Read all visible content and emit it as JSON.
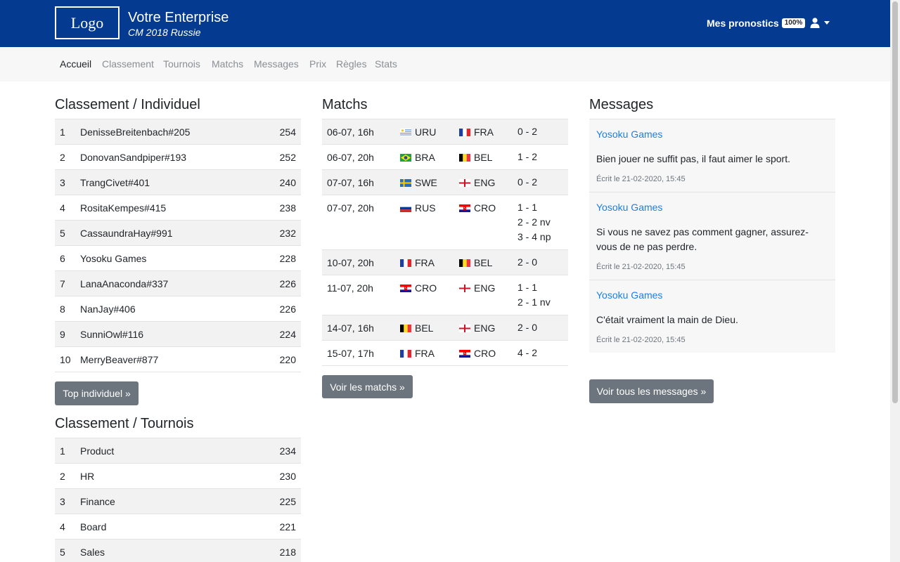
{
  "header": {
    "logo": "Logo",
    "title": "Votre Enterprise",
    "subtitle": "CM 2018 Russie",
    "pronostics_label": "Mes pronostics",
    "pronostics_badge": "100%"
  },
  "nav": [
    "Accueil",
    "Classement",
    "Tournois",
    "Matchs",
    "Messages",
    "Prix",
    "Règles",
    "Stats"
  ],
  "individual": {
    "title": "Classement / Individuel",
    "rows": [
      {
        "rank": "1",
        "name": "DenisseBreitenbach#205",
        "score": "254"
      },
      {
        "rank": "2",
        "name": "DonovanSandpiper#193",
        "score": "252"
      },
      {
        "rank": "3",
        "name": "TrangCivet#401",
        "score": "240"
      },
      {
        "rank": "4",
        "name": "RositaKempes#415",
        "score": "238"
      },
      {
        "rank": "5",
        "name": "CassaundraHay#991",
        "score": "232"
      },
      {
        "rank": "6",
        "name": "Yosoku Games",
        "score": "228"
      },
      {
        "rank": "7",
        "name": "LanaAnaconda#337",
        "score": "226"
      },
      {
        "rank": "8",
        "name": "NanJay#406",
        "score": "226"
      },
      {
        "rank": "9",
        "name": "SunniOwl#116",
        "score": "224"
      },
      {
        "rank": "10",
        "name": "MerryBeaver#877",
        "score": "220"
      }
    ],
    "button": "Top individuel »"
  },
  "tournois": {
    "title": "Classement / Tournois",
    "rows": [
      {
        "rank": "1",
        "name": "Product",
        "score": "234"
      },
      {
        "rank": "2",
        "name": "HR",
        "score": "230"
      },
      {
        "rank": "3",
        "name": "Finance",
        "score": "225"
      },
      {
        "rank": "4",
        "name": "Board",
        "score": "221"
      },
      {
        "rank": "5",
        "name": "Sales",
        "score": "218"
      }
    ]
  },
  "matches": {
    "title": "Matchs",
    "rows": [
      {
        "date": "06-07, 16h",
        "home": "URU",
        "away": "FRA",
        "scores": [
          "0 - 2"
        ]
      },
      {
        "date": "06-07, 20h",
        "home": "BRA",
        "away": "BEL",
        "scores": [
          "1 - 2"
        ]
      },
      {
        "date": "07-07, 16h",
        "home": "SWE",
        "away": "ENG",
        "scores": [
          "0 - 2"
        ]
      },
      {
        "date": "07-07, 20h",
        "home": "RUS",
        "away": "CRO",
        "scores": [
          "1 - 1",
          "2 - 2 nv",
          "3 - 4 np"
        ]
      },
      {
        "date": "10-07, 20h",
        "home": "FRA",
        "away": "BEL",
        "scores": [
          "2 - 0"
        ]
      },
      {
        "date": "11-07, 20h",
        "home": "CRO",
        "away": "ENG",
        "scores": [
          "1 - 1",
          "2 - 1 nv"
        ]
      },
      {
        "date": "14-07, 16h",
        "home": "BEL",
        "away": "ENG",
        "scores": [
          "2 - 0"
        ]
      },
      {
        "date": "15-07, 17h",
        "home": "FRA",
        "away": "CRO",
        "scores": [
          "4 - 2"
        ]
      }
    ],
    "button": "Voir les matchs »"
  },
  "messages": {
    "title": "Messages",
    "items": [
      {
        "author": "Yosoku Games",
        "text": "Bien jouer ne suffit pas, il faut aimer le sport.",
        "date": "Écrit le 21-02-2020, 15:45"
      },
      {
        "author": "Yosoku Games",
        "text": "Si vous ne savez pas comment gagner, assurez-vous de ne pas perdre.",
        "date": "Écrit le 21-02-2020, 15:45"
      },
      {
        "author": "Yosoku Games",
        "text": "C'était vraiment la main de Dieu.",
        "date": "Écrit le 21-02-2020, 15:45"
      }
    ],
    "button": "Voir tous les messages »"
  },
  "colors": {
    "header_bg": "#043a8f",
    "link": "#1a7fe8",
    "button": "#6c757d"
  },
  "icons": {
    "user": "user-icon",
    "dropdown": "caret-down-icon"
  }
}
